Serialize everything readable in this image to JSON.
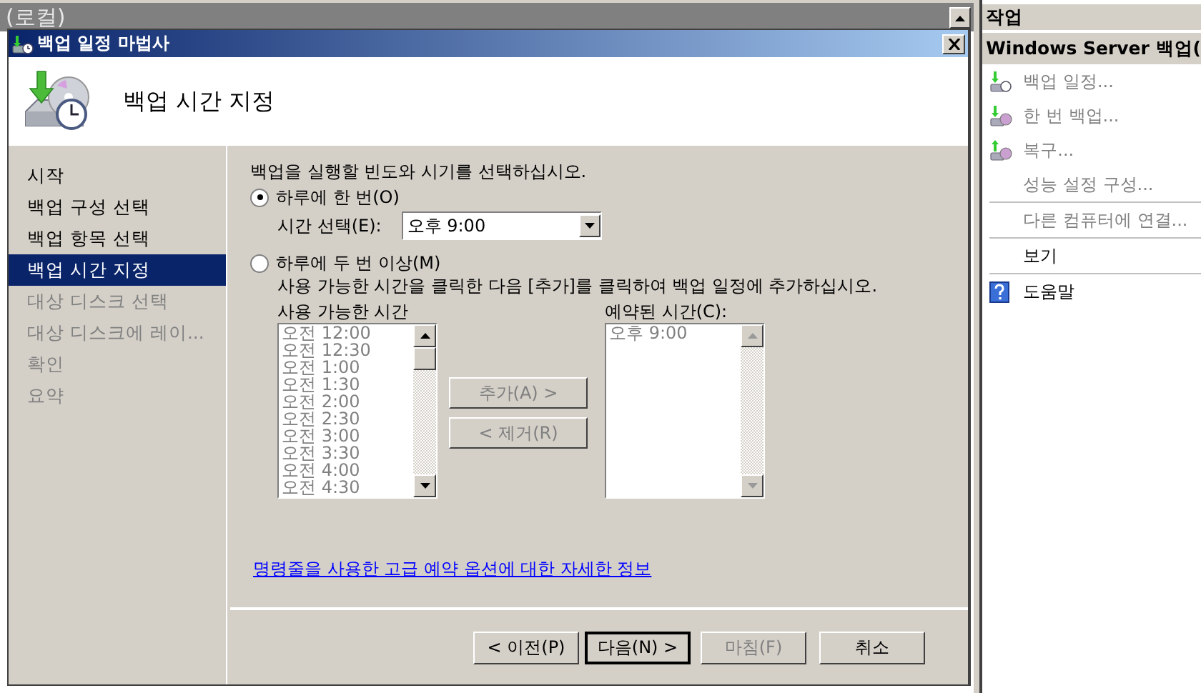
{
  "background_window": {
    "title": "(로컬)"
  },
  "dialog": {
    "title": "백업 일정 마법사",
    "heading": "백업 시간 지정",
    "steps": [
      {
        "label": "시작",
        "selected": false,
        "disabled": false
      },
      {
        "label": "백업 구성 선택",
        "selected": false,
        "disabled": false
      },
      {
        "label": "백업 항목 선택",
        "selected": false,
        "disabled": false
      },
      {
        "label": "백업 시간 지정",
        "selected": true,
        "disabled": false
      },
      {
        "label": "대상 디스크 선택",
        "selected": false,
        "disabled": true
      },
      {
        "label": "대상 디스크에 레이...",
        "selected": false,
        "disabled": true
      },
      {
        "label": "확인",
        "selected": false,
        "disabled": true
      },
      {
        "label": "요약",
        "selected": false,
        "disabled": true
      }
    ],
    "instruction": "백업을 실행할 빈도와 시기를 선택하십시오.",
    "options": [
      {
        "label": "하루에 한 번(O)",
        "selected": true
      },
      {
        "label": "하루에 두 번 이상(M)",
        "selected": false
      }
    ],
    "time_label": "시간 선택(E):",
    "time_value": "오후 9:00",
    "multi_hint": "사용 가능한 시간을 클릭한 다음 [추가]를 클릭하여 백업 일정에 추가하십시오.",
    "available": {
      "label": "사용 가능한 시간",
      "disabled": true,
      "items": [
        "오전 12:00",
        "오전 12:30",
        "오전 1:00",
        "오전 1:30",
        "오전 2:00",
        "오전 2:30",
        "오전 3:00",
        "오전 3:30",
        "오전 4:00",
        "오전 4:30"
      ]
    },
    "scheduled": {
      "label": "예약된 시간(C):",
      "disabled": true,
      "items": [
        "오후 9:00"
      ]
    },
    "move_buttons": [
      {
        "label": "추가(A) >",
        "disabled": true
      },
      {
        "label": "< 제거(R)",
        "disabled": true
      }
    ],
    "link": "명령줄을 사용한 고급 예약 옵션에 대한 자세한 정보",
    "buttons": [
      {
        "label": "< 이전(P)",
        "disabled": false,
        "default": false
      },
      {
        "label": "다음(N) >",
        "disabled": false,
        "default": true
      },
      {
        "label": "마침(F)",
        "disabled": true,
        "default": false
      },
      {
        "label": "취소",
        "disabled": false,
        "default": false
      }
    ]
  },
  "actions_pane": {
    "title": "작업",
    "section": "Windows Server 백업(",
    "groups": [
      [
        {
          "label": "백업 일정...",
          "kind": "schedule",
          "disabled": true
        },
        {
          "label": "한 번 백업...",
          "kind": "once",
          "disabled": true
        },
        {
          "label": "복구...",
          "kind": "restore",
          "disabled": true
        },
        {
          "label": "성능 설정 구성...",
          "disabled": true
        }
      ],
      [
        {
          "label": "다른 컴퓨터에 연결...",
          "disabled": true
        }
      ],
      [
        {
          "label": "보기",
          "disabled": false
        }
      ],
      [
        {
          "label": "도움말",
          "kind": "help",
          "disabled": false
        }
      ]
    ]
  }
}
